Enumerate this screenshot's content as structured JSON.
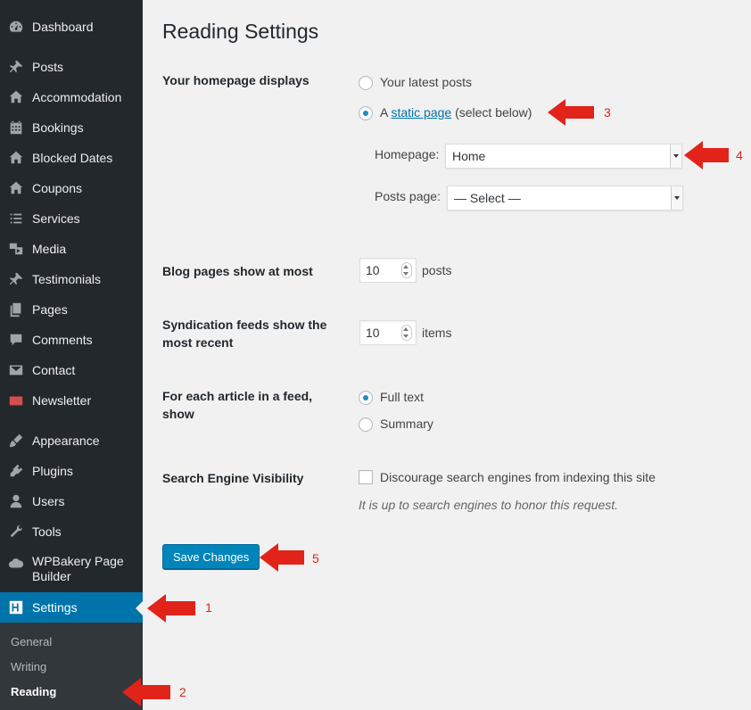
{
  "sidebar": {
    "items": [
      {
        "label": "Dashboard",
        "icon": "dashboard-icon"
      },
      {
        "label": "Posts",
        "icon": "pin-icon"
      },
      {
        "label": "Accommodation",
        "icon": "home-icon"
      },
      {
        "label": "Bookings",
        "icon": "calendar-icon"
      },
      {
        "label": "Blocked Dates",
        "icon": "home-icon"
      },
      {
        "label": "Coupons",
        "icon": "home-icon"
      },
      {
        "label": "Services",
        "icon": "list-icon"
      },
      {
        "label": "Media",
        "icon": "media-icon"
      },
      {
        "label": "Testimonials",
        "icon": "pin-icon"
      },
      {
        "label": "Pages",
        "icon": "pages-icon"
      },
      {
        "label": "Comments",
        "icon": "comment-icon"
      },
      {
        "label": "Contact",
        "icon": "mail-icon"
      },
      {
        "label": "Newsletter",
        "icon": "newsletter-icon"
      },
      {
        "label": "Appearance",
        "icon": "brush-icon"
      },
      {
        "label": "Plugins",
        "icon": "plug-icon"
      },
      {
        "label": "Users",
        "icon": "user-icon"
      },
      {
        "label": "Tools",
        "icon": "wrench-icon"
      },
      {
        "label": "WPBakery Page Builder",
        "icon": "cloud-icon"
      },
      {
        "label": "Settings",
        "icon": "settings-icon"
      }
    ],
    "submenu": [
      {
        "label": "General"
      },
      {
        "label": "Writing"
      },
      {
        "label": "Reading"
      }
    ]
  },
  "page": {
    "title": "Reading Settings"
  },
  "homepage_displays": {
    "label": "Your homepage displays",
    "option_latest": "Your latest posts",
    "option_static_prefix": "A",
    "option_static_link": "static page",
    "option_static_suffix": "(select below)",
    "selected": "static page",
    "homepage_label": "Homepage:",
    "homepage_value": "Home",
    "posts_page_label": "Posts page:",
    "posts_page_value": "— Select —"
  },
  "blog_pages": {
    "label": "Blog pages show at most",
    "value": "10",
    "unit": "posts"
  },
  "syndication": {
    "label": "Syndication feeds show the most recent",
    "value": "10",
    "unit": "items"
  },
  "feed_article": {
    "label": "For each article in a feed, show",
    "option_full": "Full text",
    "option_summary": "Summary",
    "selected": "Full text"
  },
  "search_visibility": {
    "label": "Search Engine Visibility",
    "checkbox_label": "Discourage search engines from indexing this site",
    "checked": false,
    "description": "It is up to search engines to honor this request."
  },
  "actions": {
    "save_label": "Save Changes"
  },
  "annotations": [
    "1",
    "2",
    "3",
    "4",
    "5"
  ],
  "colors": {
    "sidebar_bg": "#23282d",
    "accent": "#0073aa",
    "annotation": "#e2231a"
  }
}
